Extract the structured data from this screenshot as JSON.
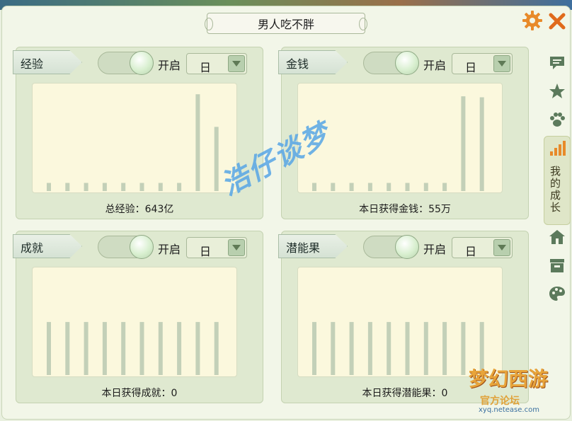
{
  "window": {
    "title": "男人吃不胖"
  },
  "icons": {
    "settings": "gear-icon",
    "close": "close-icon"
  },
  "panels": [
    {
      "id": "exp",
      "tag": "经验",
      "toggle_label": "开启",
      "period": "日",
      "summary": "总经验：643亿",
      "bars": [
        0.08,
        0.08,
        0.08,
        0.08,
        0.08,
        0.08,
        0.08,
        0.08,
        0.95,
        0.63
      ]
    },
    {
      "id": "money",
      "tag": "金钱",
      "toggle_label": "开启",
      "period": "日",
      "summary": "本日获得金钱：55万",
      "bars": [
        0.08,
        0.08,
        0.08,
        0.08,
        0.08,
        0.08,
        0.08,
        0.08,
        0.93,
        0.92
      ]
    },
    {
      "id": "achievement",
      "tag": "成就",
      "toggle_label": "开启",
      "period": "日",
      "summary": "本日获得成就：0",
      "bars": [
        0.52,
        0.52,
        0.52,
        0.52,
        0.52,
        0.52,
        0.52,
        0.52,
        0.52,
        0.52
      ]
    },
    {
      "id": "potential",
      "tag": "潜能果",
      "toggle_label": "开启",
      "period": "日",
      "summary": "本日获得潜能果：0",
      "bars": [
        0.52,
        0.52,
        0.52,
        0.52,
        0.52,
        0.52,
        0.52,
        0.52,
        0.52,
        0.52
      ]
    }
  ],
  "side_rail": {
    "items": [
      "chat-icon",
      "star-icon",
      "paw-icon",
      "signal-icon",
      "house-icon",
      "box-icon",
      "palette-icon"
    ],
    "active_label": "我的成长"
  },
  "watermark": "浩仔谈梦",
  "logo": {
    "name": "梦幻西游",
    "sub": "官方论坛",
    "url": "xyq.netease.com"
  },
  "colors": {
    "bar": "#c3d0b8",
    "chart_bg": "#fbf8dd",
    "panel_bg": "#dfe9d0",
    "accent": "#e88a2a"
  }
}
